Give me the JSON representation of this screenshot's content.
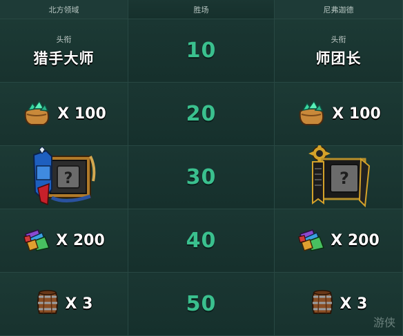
{
  "headers": {
    "left": "北方领域",
    "middle": "胜场",
    "right": "尼弗迦德"
  },
  "rows": [
    {
      "wins": "10",
      "left": {
        "type": "title",
        "small": "头衔",
        "big": "猎手大师"
      },
      "right": {
        "type": "title",
        "small": "头衔",
        "big": "师团长"
      }
    },
    {
      "wins": "20",
      "left": {
        "type": "reward",
        "icon": "ore-sack-icon",
        "qty": "X 100"
      },
      "right": {
        "type": "reward",
        "icon": "ore-sack-icon",
        "qty": "X 100"
      }
    },
    {
      "wins": "30",
      "left": {
        "type": "avatar-frame",
        "icon": "northern-realms-mystery-frame-icon"
      },
      "right": {
        "type": "avatar-frame",
        "icon": "nilfgaard-mystery-frame-icon"
      }
    },
    {
      "wins": "40",
      "left": {
        "type": "reward",
        "icon": "scraps-icon",
        "qty": "X 200"
      },
      "right": {
        "type": "reward",
        "icon": "scraps-icon",
        "qty": "X 200"
      }
    },
    {
      "wins": "50",
      "left": {
        "type": "reward",
        "icon": "keg-icon",
        "qty": "X 3"
      },
      "right": {
        "type": "reward",
        "icon": "keg-icon",
        "qty": "X 3"
      }
    }
  ],
  "watermark": "游侠",
  "colors": {
    "background": "#17302c",
    "wins_text": "#3ac08e",
    "grid_line": "#284843"
  }
}
